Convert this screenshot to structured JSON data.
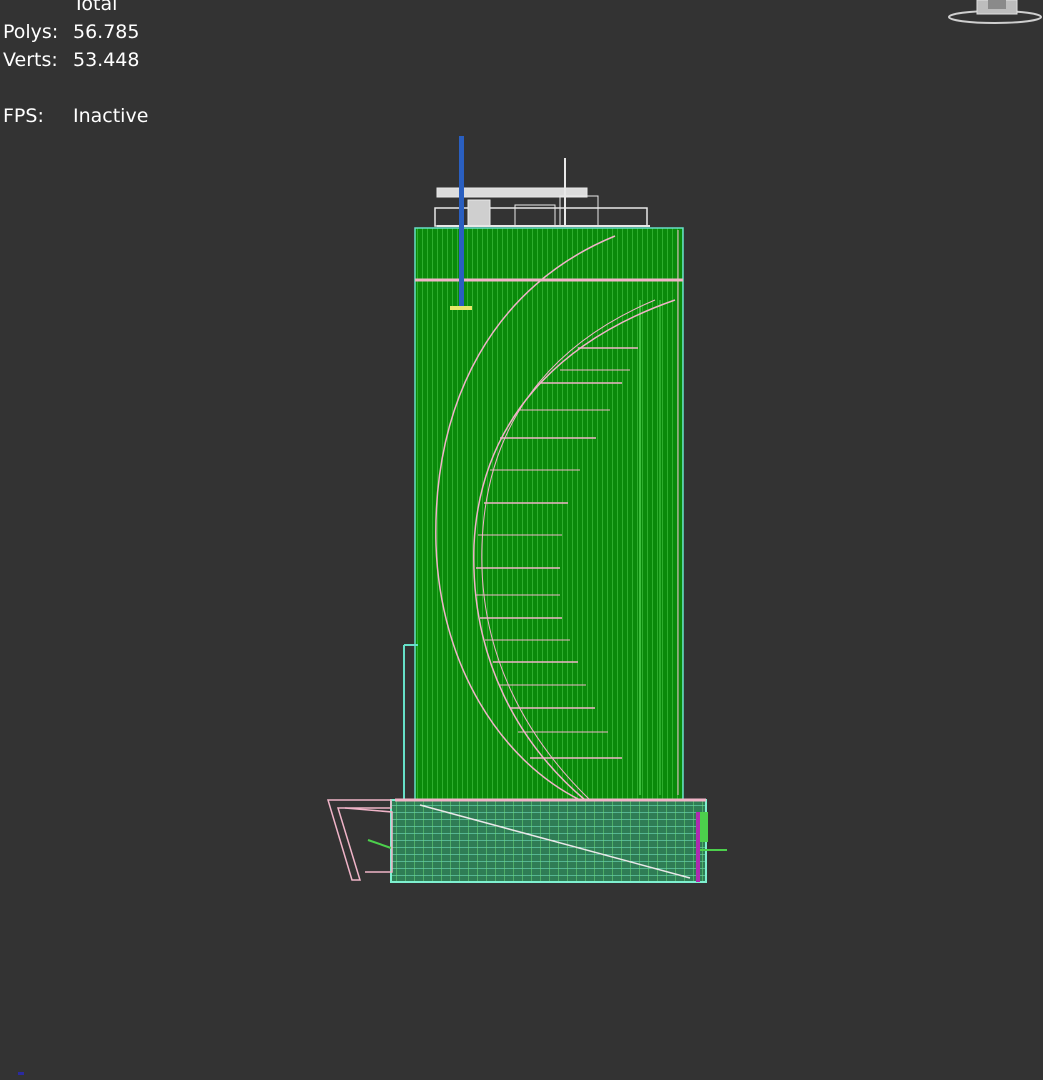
{
  "stats": {
    "header": "Total",
    "rows": [
      {
        "label": "Polys:",
        "value": "56.785"
      },
      {
        "label": "Verts:",
        "value": "53.448"
      },
      {
        "label": "FPS:",
        "value": "Inactive"
      }
    ]
  },
  "colors": {
    "background": "#333333",
    "text": "#ffffff",
    "facade": "#0a8a0a",
    "wire_green": "#4cd04c",
    "wire_pink": "#f0b4c8",
    "wire_cyan": "#66e0c8",
    "wire_white": "#e8e8e8",
    "mast_blue": "#2a5fc0"
  },
  "icons": {
    "viewcube": "viewcube-icon",
    "axis": "axis-tripod-icon"
  }
}
